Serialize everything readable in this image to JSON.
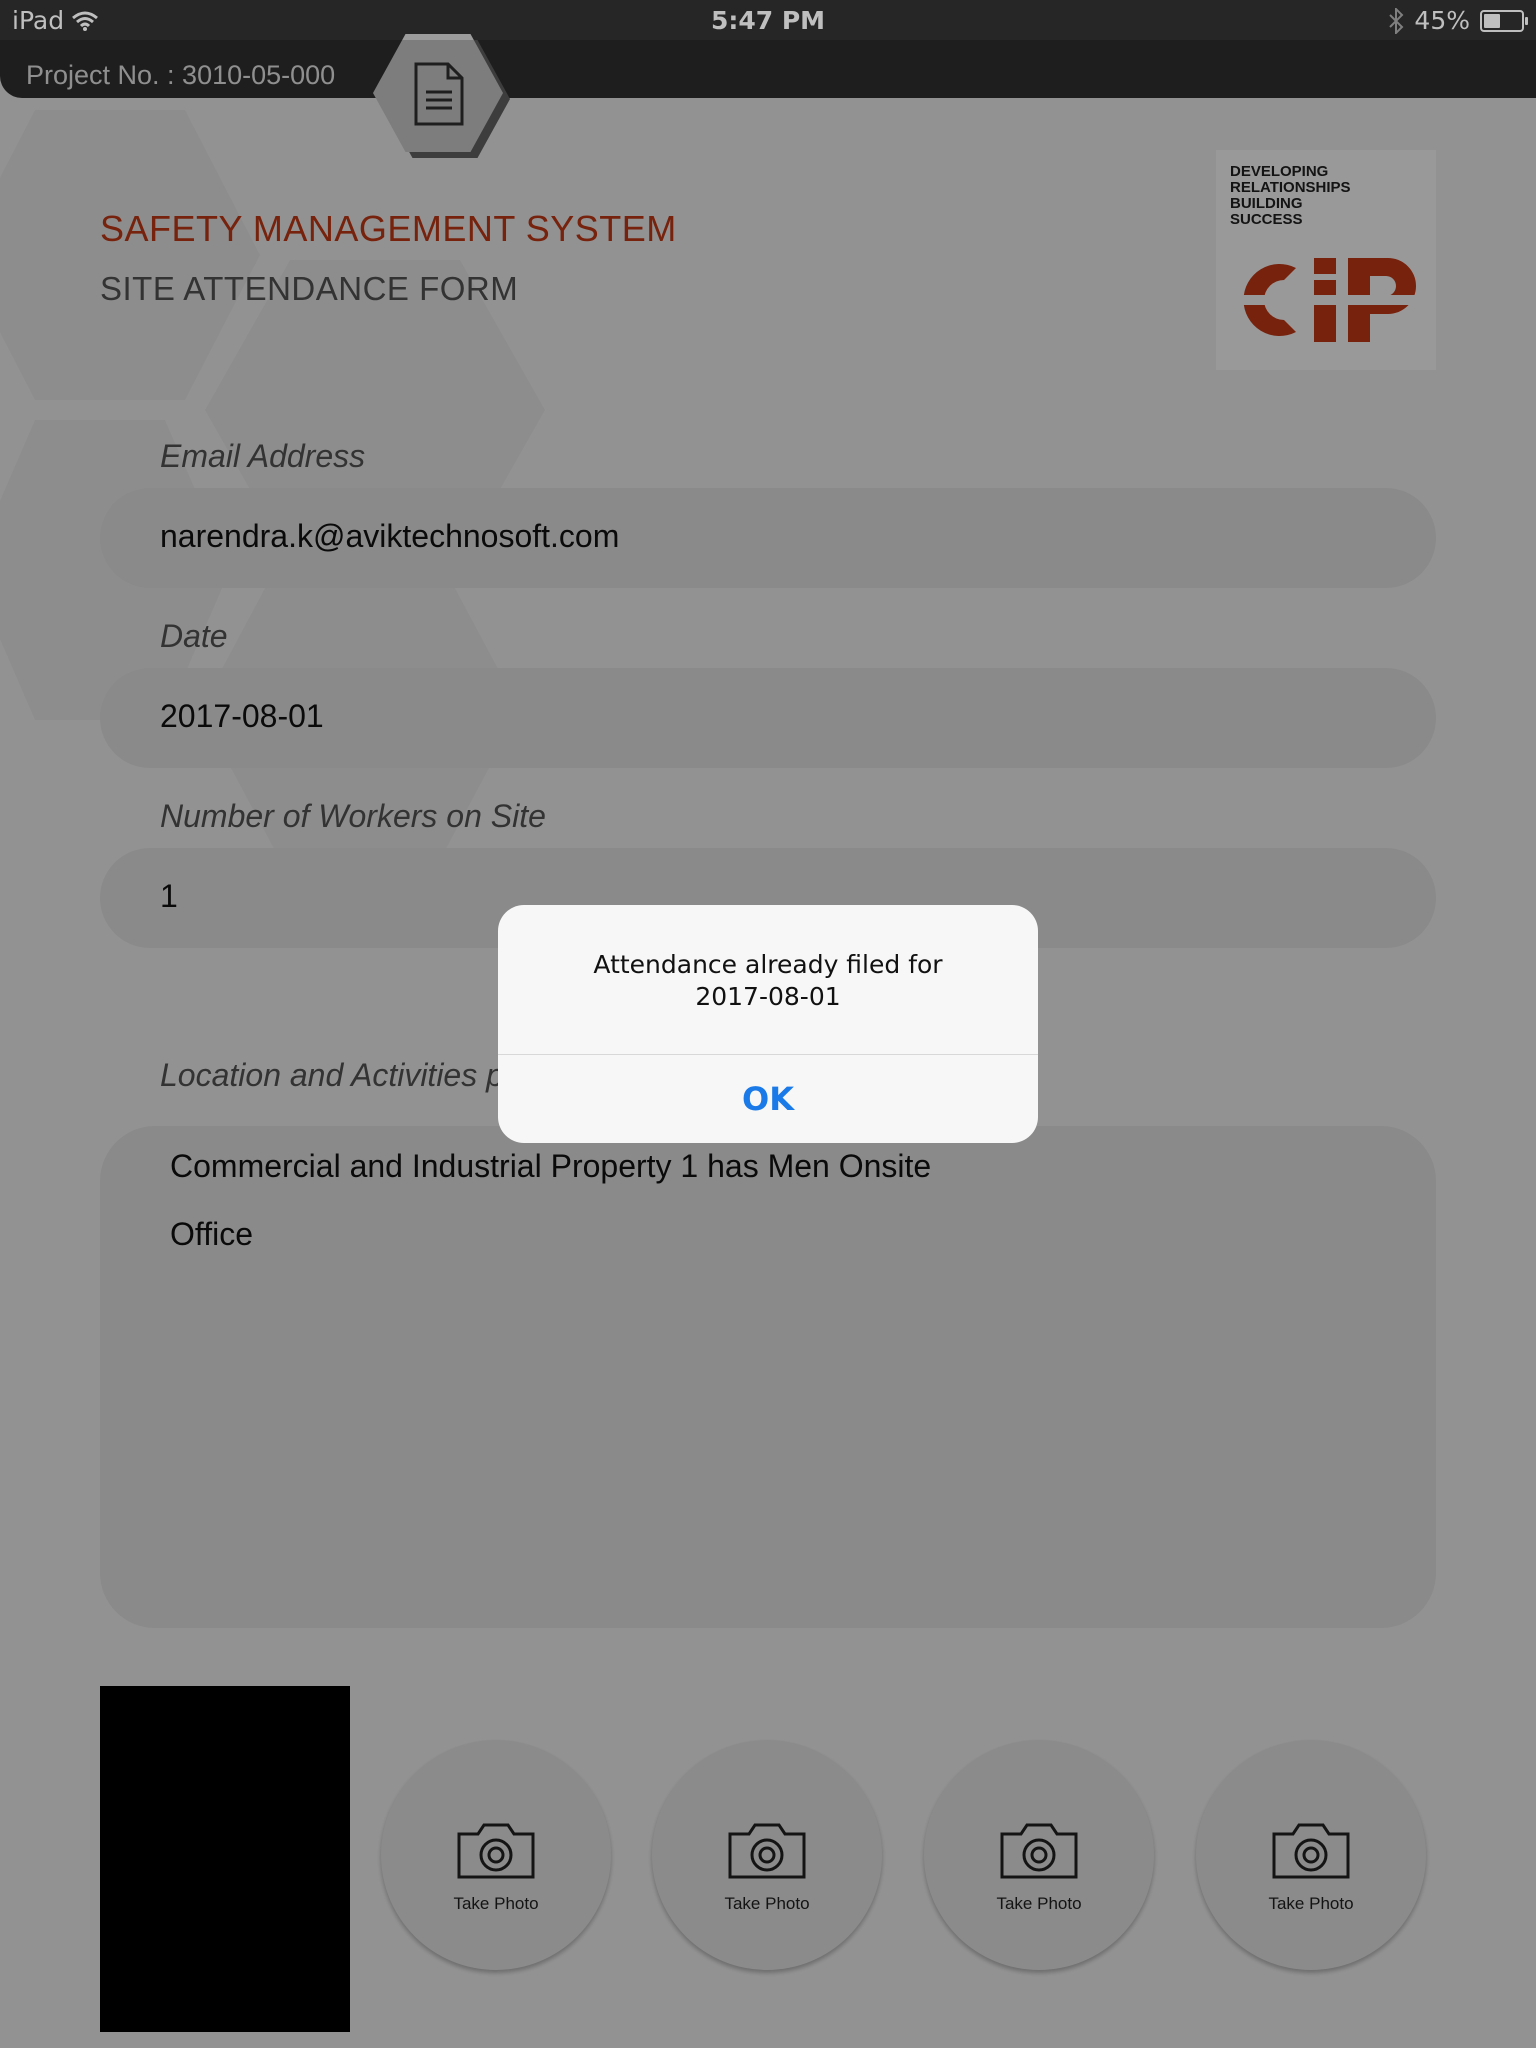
{
  "status_bar": {
    "device": "iPad",
    "time": "5:47 PM",
    "battery": "45%",
    "battery_level": 0.45
  },
  "header": {
    "project_no": "Project No. : 3010-05-000",
    "doc_icon": "document-icon"
  },
  "page": {
    "title": "SAFETY MANAGEMENT SYSTEM",
    "subtitle": "SITE  ATTENDANCE FORM",
    "title_color": "#c53a16"
  },
  "logo": {
    "tagline": [
      "DEVELOPING",
      "RELATIONSHIPS",
      "BUILDING",
      "SUCCESS"
    ],
    "mark": "CIP",
    "color": "#c53a16"
  },
  "form": {
    "email": {
      "label": "Email Address",
      "value": "narendra.k@aviktechnosoft.com"
    },
    "date": {
      "label": "Date",
      "value": "2017-08-01"
    },
    "workers": {
      "label": "Number of Workers on Site",
      "value": "1"
    },
    "activities": {
      "label": "Location and Activities p",
      "lines": [
        "Commercial and Industrial Property 1 has Men Onsite",
        "Office"
      ]
    }
  },
  "photos": {
    "button_label": "Take Photo",
    "buttons": [
      "Take Photo",
      "Take Photo",
      "Take Photo",
      "Take Photo"
    ],
    "icon": "camera-icon"
  },
  "alert": {
    "message_line1": "Attendance already filed for",
    "message_line2": "2017-08-01",
    "ok_label": "OK",
    "ok_color": "#1a7ae8"
  }
}
